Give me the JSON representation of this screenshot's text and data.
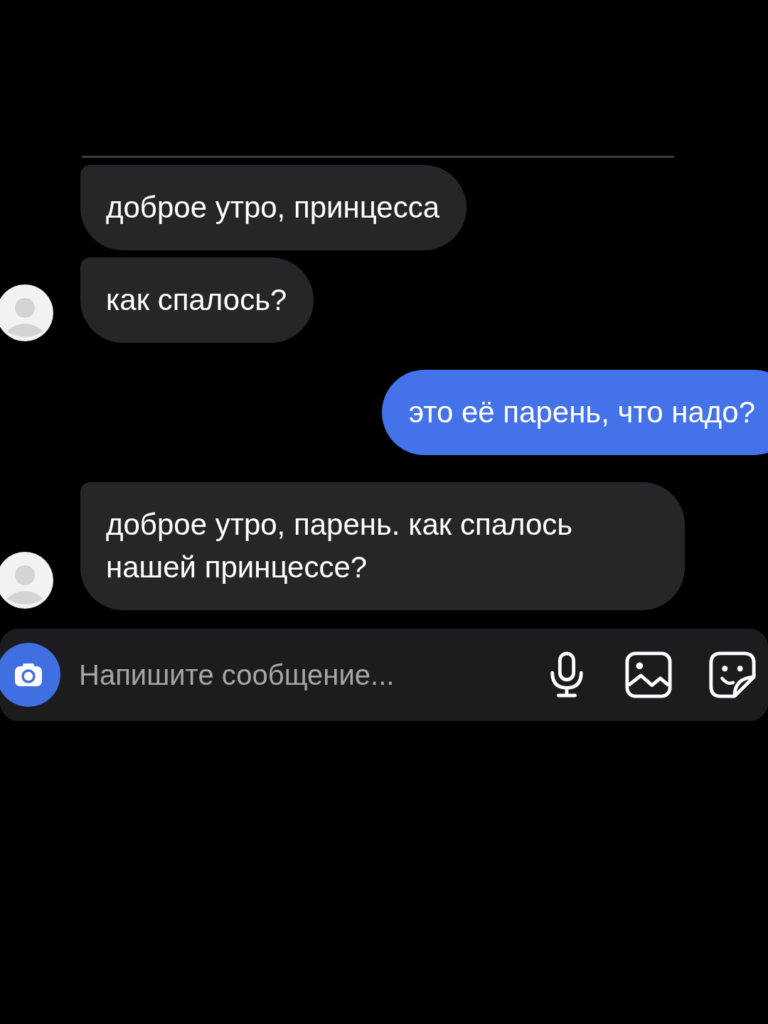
{
  "messages": [
    {
      "kind": "incoming",
      "text": "доброе утро, принцесса",
      "avatar": false
    },
    {
      "kind": "incoming",
      "text": "как спалось?",
      "avatar": true
    },
    {
      "kind": "outgoing",
      "text": "это её парень, что надо?"
    },
    {
      "kind": "incoming",
      "text": "доброе утро, парень. как спалось нашей принцессе?",
      "avatar": true
    }
  ],
  "composer": {
    "placeholder": "Напишите сообщение..."
  }
}
